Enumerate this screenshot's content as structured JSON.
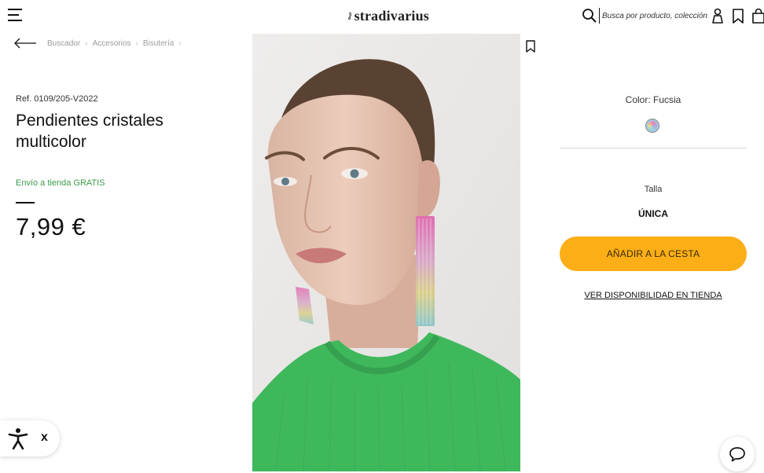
{
  "header": {
    "logo_text": "stradivarius",
    "search_placeholder": "Busca por producto, colección..."
  },
  "breadcrumb": [
    "Buscador",
    "Accesorios",
    "Bisutería"
  ],
  "product": {
    "ref": "Ref. 0109/205-V2022",
    "title": "Pendientes cristales multicolor",
    "shipping": "Envío a tienda GRATIS",
    "price": "7,99 €"
  },
  "options": {
    "color_label": "Color: Fucsia",
    "size_label": "Talla",
    "size_value": "ÚNICA"
  },
  "actions": {
    "add_to_cart": "AÑADIR A LA CESTA",
    "store_availability": "VER DISPONIBILIDAD EN TIENDA"
  },
  "accessibility": {
    "close_label": "x"
  },
  "colors": {
    "accent": "#fcae17",
    "shipping_green": "#3b9b4a",
    "sweater_green": "#3fb85c"
  }
}
